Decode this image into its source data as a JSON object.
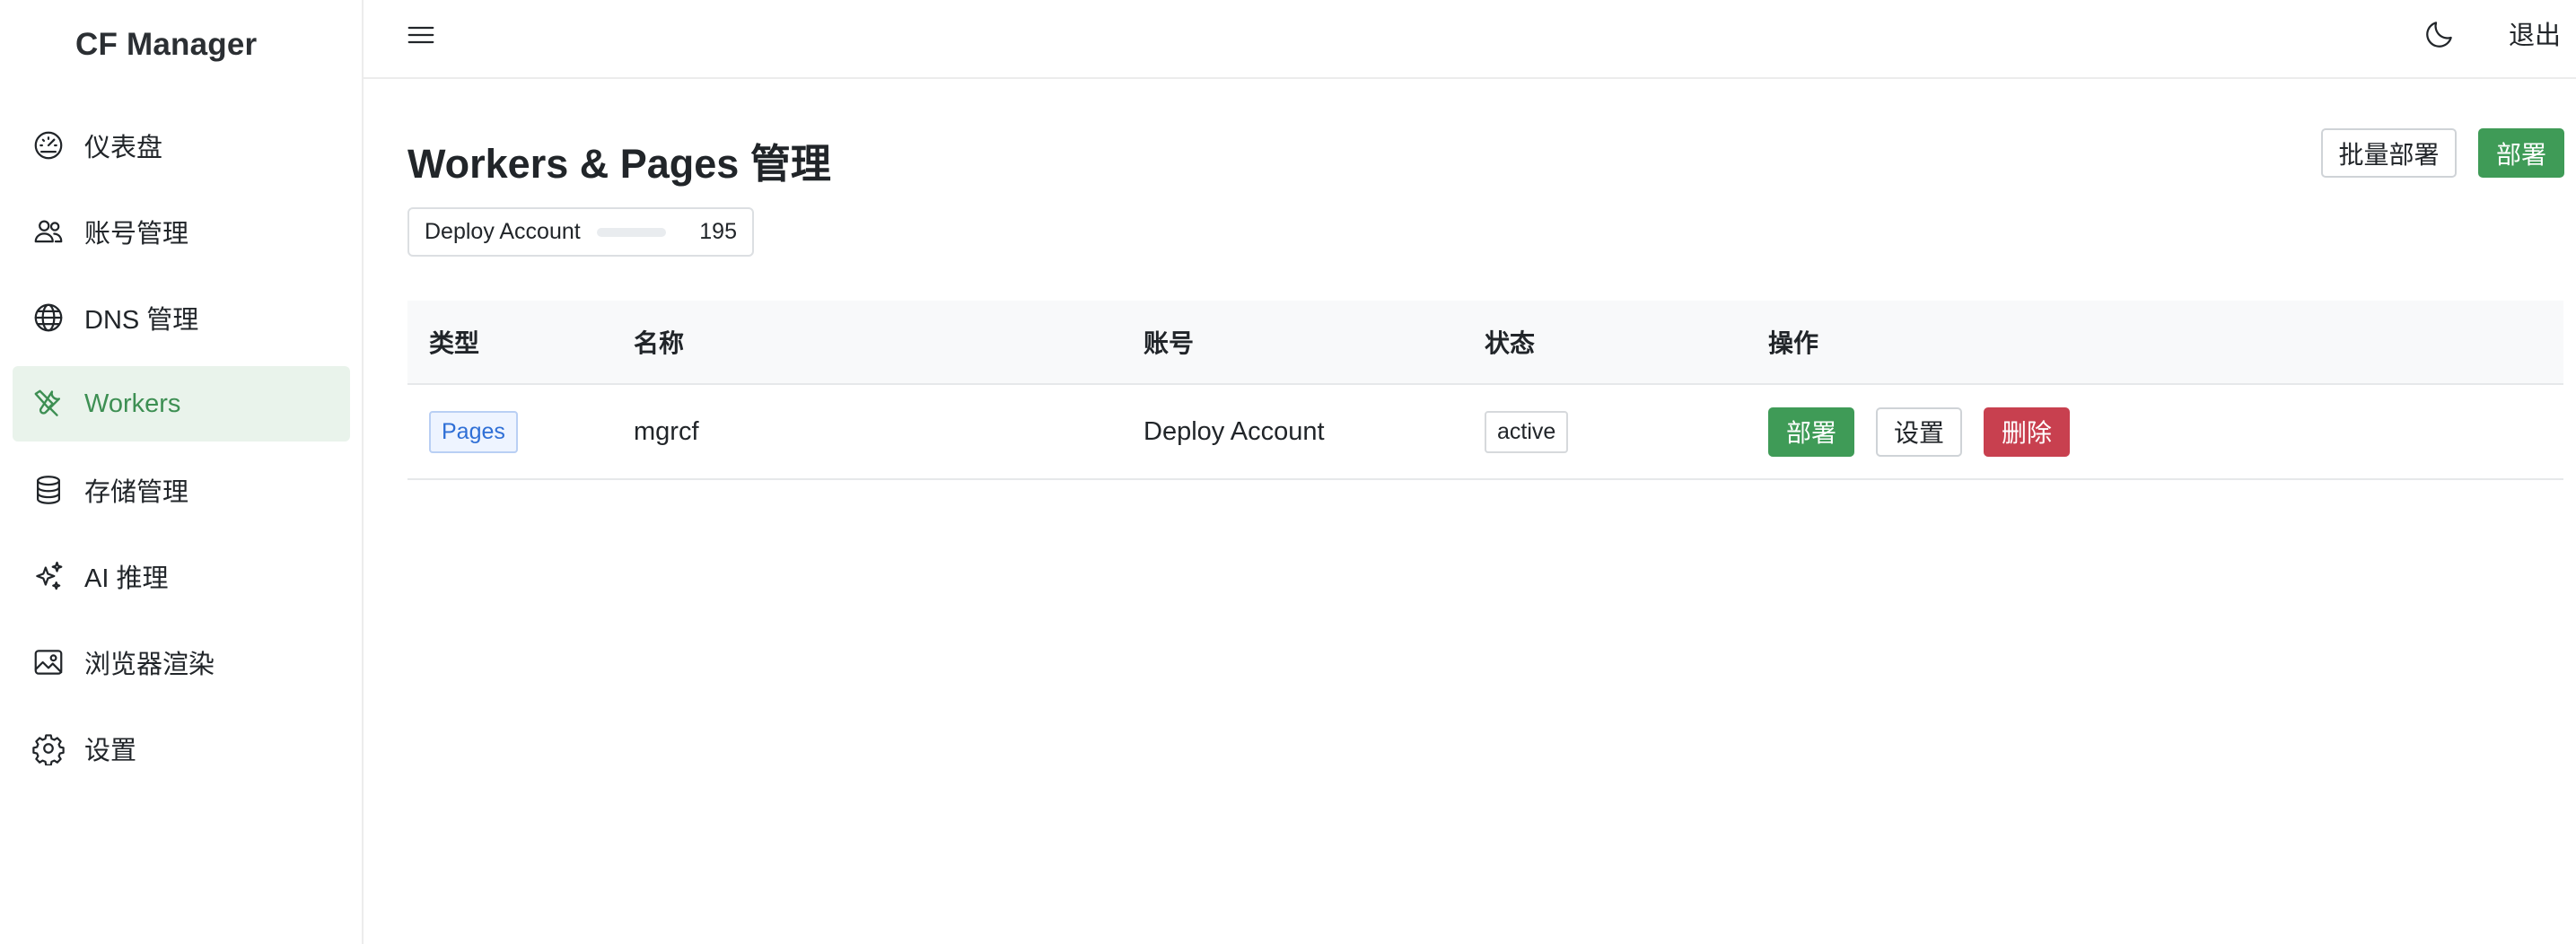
{
  "app": {
    "title": "CF Manager"
  },
  "sidebar": {
    "items": [
      {
        "label": "仪表盘",
        "icon": "speedometer-icon",
        "active": false
      },
      {
        "label": "账号管理",
        "icon": "users-icon",
        "active": false
      },
      {
        "label": "DNS 管理",
        "icon": "globe-icon",
        "active": false
      },
      {
        "label": "Workers",
        "icon": "tools-icon",
        "active": true
      },
      {
        "label": "存储管理",
        "icon": "database-icon",
        "active": false
      },
      {
        "label": "AI 推理",
        "icon": "sparkles-icon",
        "active": false
      },
      {
        "label": "浏览器渲染",
        "icon": "image-icon",
        "active": false
      },
      {
        "label": "设置",
        "icon": "gear-icon",
        "active": false
      }
    ]
  },
  "topbar": {
    "logout_label": "退出",
    "theme_icon": "moon-icon",
    "menu_icon": "hamburger-icon"
  },
  "page": {
    "title": "Workers & Pages 管理",
    "batch_deploy_label": "批量部署",
    "deploy_label": "部署"
  },
  "account_filter": {
    "name": "Deploy Account",
    "count": "195",
    "usage_fraction": 0.0
  },
  "table": {
    "headers": [
      "类型",
      "名称",
      "账号",
      "状态",
      "操作"
    ],
    "rows": [
      {
        "type": "Pages",
        "name": "mgrcf",
        "account": "Deploy Account",
        "status": "active",
        "actions": {
          "deploy": "部署",
          "settings": "设置",
          "delete": "删除"
        }
      }
    ]
  },
  "colors": {
    "accent_green": "#3f9b57",
    "active_nav_bg": "#e9f3eb",
    "danger_red": "#c8404f",
    "pages_badge_blue": "#2f6fd6"
  }
}
